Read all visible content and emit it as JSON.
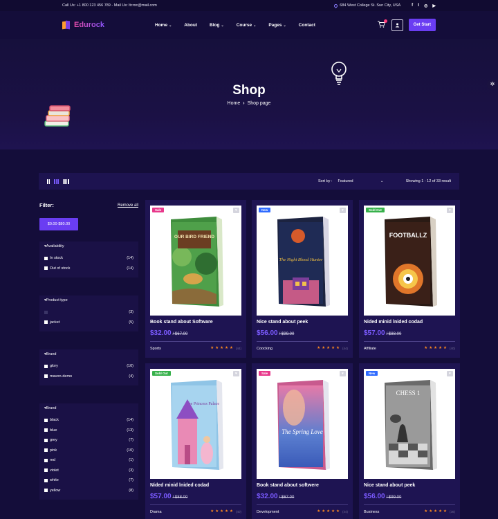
{
  "topbar": {
    "contact": "Call Us: +1 800 123 456 789 - Mail Us: ltcroc@mail.com",
    "address": "684 West College St. Sun City, USA",
    "social": [
      "f",
      "t",
      "ig",
      "yt"
    ]
  },
  "header": {
    "brand": "Edurock",
    "nav": [
      {
        "label": "Home",
        "dropdown": true
      },
      {
        "label": "About",
        "dropdown": false
      },
      {
        "label": "Blog",
        "dropdown": true
      },
      {
        "label": "Course",
        "dropdown": true
      },
      {
        "label": "Pages",
        "dropdown": true
      },
      {
        "label": "Contact",
        "dropdown": false
      }
    ],
    "cta": "Get Start"
  },
  "hero": {
    "title": "Shop",
    "crumb_home": "Home",
    "crumb_current": "Shop page"
  },
  "toolbar": {
    "sort_label": "Sort by :",
    "sort_value": "Featured",
    "showing": "Showing 1 - 12 of 33 result"
  },
  "filter": {
    "title": "Filter:",
    "remove_all": "Remove all",
    "price": "$0.00-$80.00",
    "groups": [
      {
        "title": "Availability",
        "items": [
          {
            "label": "In stock",
            "count": "(14)"
          },
          {
            "label": "Out of stock",
            "count": "(14)"
          }
        ]
      },
      {
        "title": "Product type",
        "items": [
          {
            "label": "",
            "count": "(3)"
          },
          {
            "label": "jacket",
            "count": "(5)"
          }
        ]
      },
      {
        "title": "Brand",
        "items": [
          {
            "label": "glory",
            "count": "(10)"
          },
          {
            "label": "mavon-demo",
            "count": "(4)"
          }
        ]
      },
      {
        "title": "Brand",
        "items": [
          {
            "label": "black",
            "count": "(14)"
          },
          {
            "label": "blue",
            "count": "(13)"
          },
          {
            "label": "grey",
            "count": "(7)"
          },
          {
            "label": "pink",
            "count": "(10)"
          },
          {
            "label": "red",
            "count": "(1)"
          },
          {
            "label": "violet",
            "count": "(3)"
          },
          {
            "label": "white",
            "count": "(7)"
          },
          {
            "label": "yellow",
            "count": "(8)"
          }
        ]
      }
    ]
  },
  "products": [
    {
      "badge": "Sale",
      "title": "Book stand about Software",
      "price": "$32.00",
      "old": "/ $67.00",
      "category": "Sports",
      "rating": 5,
      "reviews": "(44)",
      "cover_text": "OUR BIRD FRIEND"
    },
    {
      "badge": "New",
      "title": "Nice stand about peek",
      "price": "$56.00",
      "old": "/ $99.00",
      "category": "Coocking",
      "rating": 5,
      "reviews": "(44)",
      "cover_text": "The Night Blood Hunter"
    },
    {
      "badge": "Sold Out",
      "title": "Nided minid lnided codad",
      "price": "$57.00",
      "old": "/ $88.00",
      "category": "Affiliate",
      "rating": 5,
      "reviews": "(40)",
      "cover_text": "FOOTBALLZ"
    },
    {
      "badge": "Sold Out",
      "title": "Nided minid lnided codad",
      "price": "$57.00",
      "old": "/ $88.00",
      "category": "Drama",
      "rating": 5,
      "reviews": "(40)",
      "cover_text": "The Princess Palace"
    },
    {
      "badge": "Sale",
      "title": "Book stand about softwere",
      "price": "$32.00",
      "old": "/ $67.00",
      "category": "Development",
      "rating": 5,
      "reviews": "(44)",
      "cover_text": "The Spring Love"
    },
    {
      "badge": "New",
      "title": "Nice stand about peek",
      "price": "$56.00",
      "old": "/ $99.00",
      "category": "Business",
      "rating": 5,
      "reviews": "(36)",
      "cover_text": "CHESS 1"
    }
  ]
}
